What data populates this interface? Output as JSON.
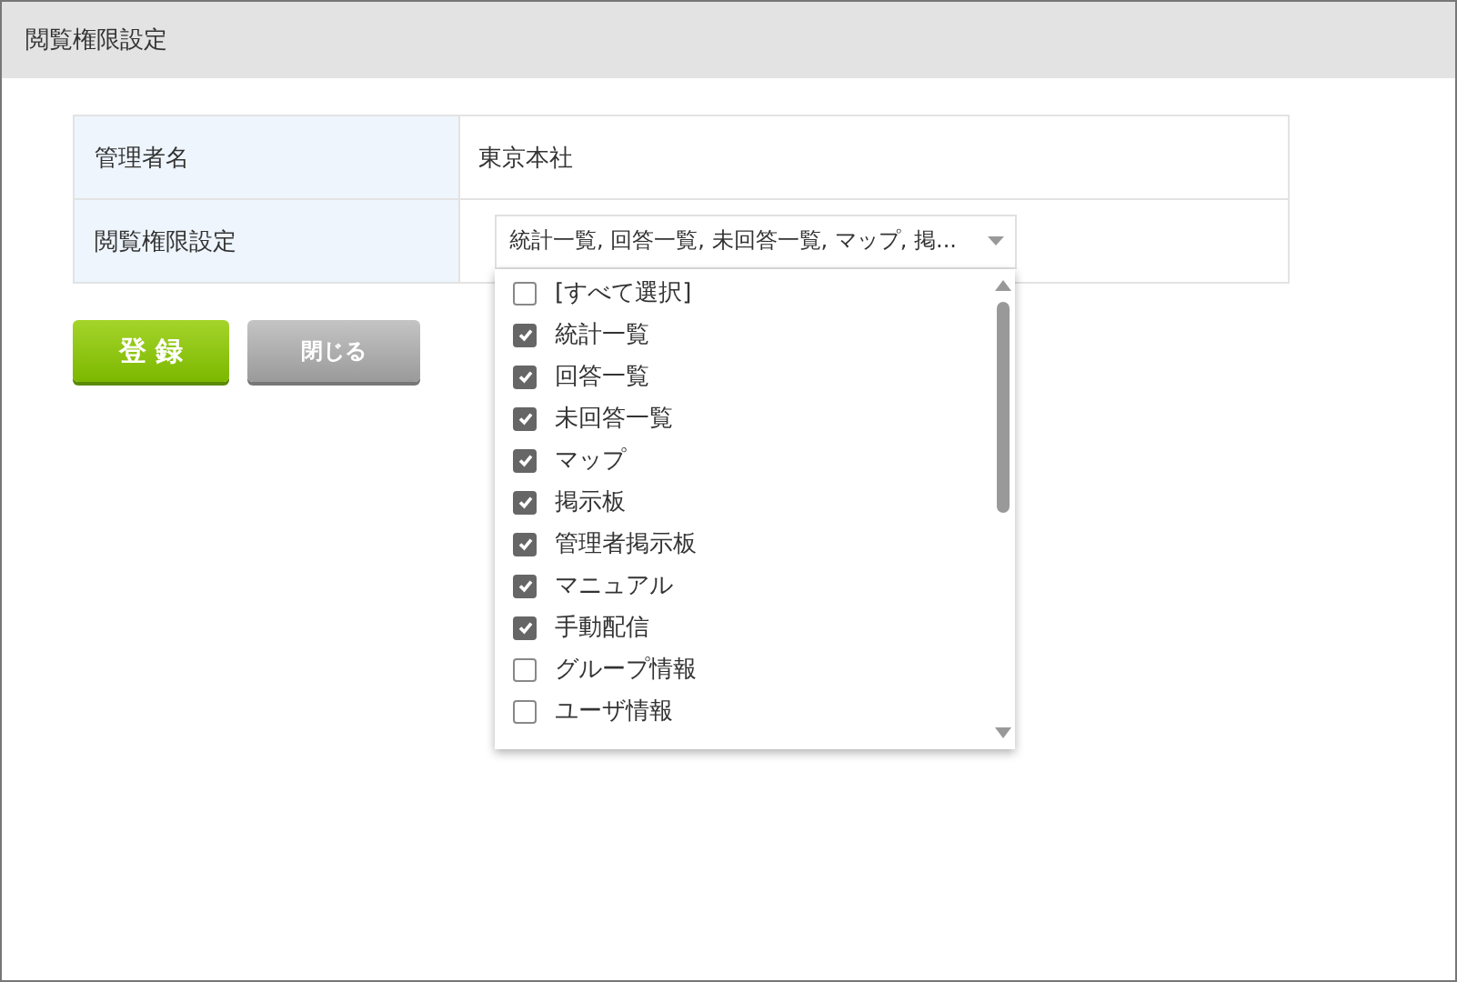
{
  "window": {
    "title": "閲覧権限設定"
  },
  "form": [
    {
      "label": "管理者名",
      "kind": "text",
      "value": "東京本社"
    },
    {
      "label": "閲覧権限設定",
      "kind": "multiselect",
      "value": "統計一覧, 回答一覧, 未回答一覧, マップ, 掲...",
      "expanded": true,
      "options": [
        {
          "label": "[すべて選択]",
          "checked": false
        },
        {
          "label": "統計一覧",
          "checked": true
        },
        {
          "label": "回答一覧",
          "checked": true
        },
        {
          "label": "未回答一覧",
          "checked": true
        },
        {
          "label": "マップ",
          "checked": true
        },
        {
          "label": "掲示板",
          "checked": true
        },
        {
          "label": "管理者掲示板",
          "checked": true
        },
        {
          "label": "マニュアル",
          "checked": true
        },
        {
          "label": "手動配信",
          "checked": true
        },
        {
          "label": "グループ情報",
          "checked": false
        },
        {
          "label": "ユーザ情報",
          "checked": false
        }
      ]
    }
  ],
  "buttons": [
    {
      "label": "登 録",
      "kind": "primary"
    },
    {
      "label": "閉じる",
      "kind": "secondary"
    }
  ]
}
